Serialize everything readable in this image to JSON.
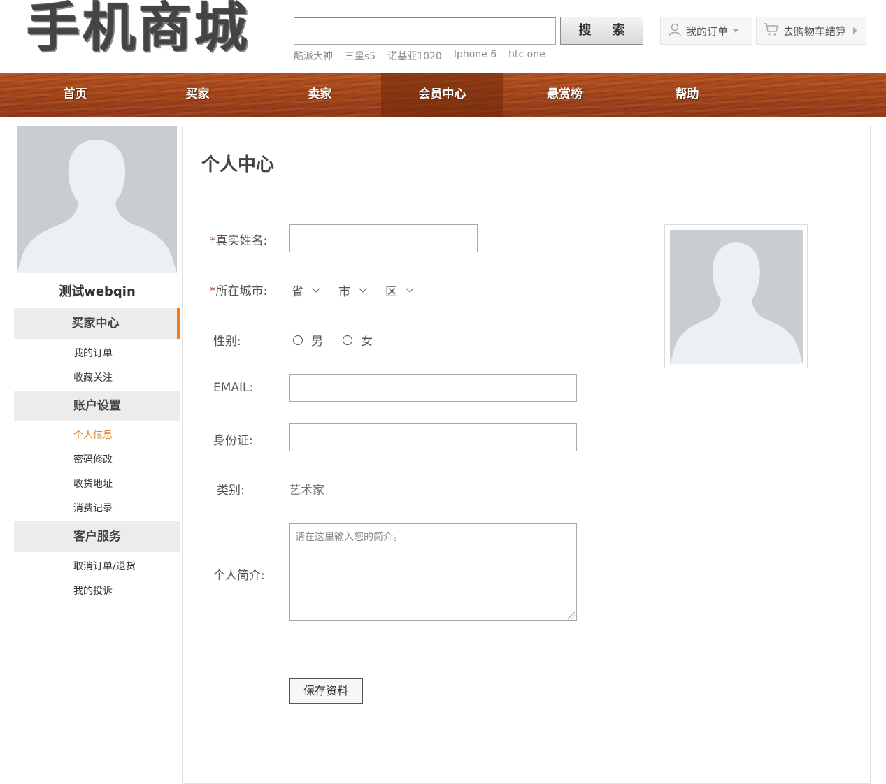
{
  "header": {
    "logo_text": "手机商城",
    "search": {
      "placeholder": "",
      "button_label": "搜 索"
    },
    "hot_words": [
      "酷派大神",
      "三星s5",
      "诺基亚1020",
      "Iphone 6",
      "htc one"
    ],
    "my_orders_label": "我的订单",
    "cart_label": "去购物车结算"
  },
  "nav": {
    "items": [
      "首页",
      "买家",
      "卖家",
      "会员中心",
      "悬赏榜",
      "帮助"
    ],
    "active": "会员中心"
  },
  "sidebar": {
    "username": "测试webqin",
    "sections": [
      {
        "title": "买家中心",
        "links": [
          "我的订单",
          "收藏关注"
        ]
      },
      {
        "title": "账户设置",
        "links": [
          "个人信息",
          "密码修改",
          "收货地址",
          "消费记录"
        ]
      },
      {
        "title": "客户服务",
        "links": [
          "取消订单/退货",
          "我的投诉"
        ]
      }
    ],
    "active_link": "个人信息"
  },
  "main": {
    "title": "个人中心",
    "form": {
      "name_label": "真实姓名:",
      "city_label": "所在城市:",
      "province": "省",
      "city": "市",
      "district": "区",
      "gender_label": "性别:",
      "male": "男",
      "female": "女",
      "email_label": "EMAIL:",
      "id_label": "身份证:",
      "category_label": "类别:",
      "category_value": "艺术家",
      "bio_label": "个人简介:",
      "bio_placeholder": "请在这里输入您的简介。",
      "required_mark": "*",
      "save_label": "保存资料"
    }
  },
  "colors": {
    "accent_orange": "#f07a1a",
    "active_link": "#e07b1e",
    "nav_wood": "#a4451a",
    "required": "#c0392b"
  }
}
